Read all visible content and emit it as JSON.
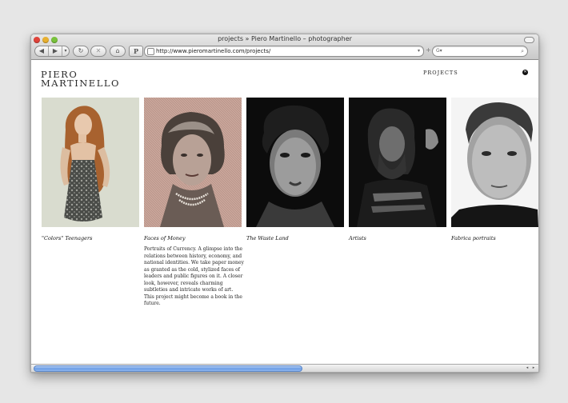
{
  "window": {
    "title": "projects » Piero Martinello – photographer"
  },
  "toolbar": {
    "back_icon": "◀",
    "forward_icon": "▶",
    "menu_icon": "▾",
    "reload_icon": "↻",
    "stop_icon": "✕",
    "home_icon": "⌂",
    "p_label": "P",
    "url": "http://www.pieromartinello.com/projects/",
    "add_icon": "+",
    "search_value": "",
    "search_prefix": "G▾",
    "search_icon": "⌕",
    "dropdown_icon": "▾"
  },
  "site": {
    "logo_line1": "PIERO",
    "logo_line2": "MARTINELLO",
    "nav_projects": "PROJECTS",
    "close_icon": "✕"
  },
  "projects": [
    {
      "caption": "\"Colors\" Teenagers"
    },
    {
      "caption": "Faces of Money"
    },
    {
      "caption": "The Waste Land"
    },
    {
      "caption": "Artists"
    },
    {
      "caption": "Fabrica portraits"
    }
  ],
  "faces_of_money_description": "Portraits of Currency. A glimpse into the relations between history, economy, and national identities. We take paper money as granted as the cold, stylized faces of leaders and public figures on it. A closer look, however, reveals charming subtleties and intricate works of art. This project might become a book in the future.",
  "scrollbar": {
    "left_arrow": "◂",
    "right_arrow": "▸"
  },
  "colors": {
    "accent_scroll": "#6c9ee6",
    "page_bg": "#e6e6e6"
  }
}
